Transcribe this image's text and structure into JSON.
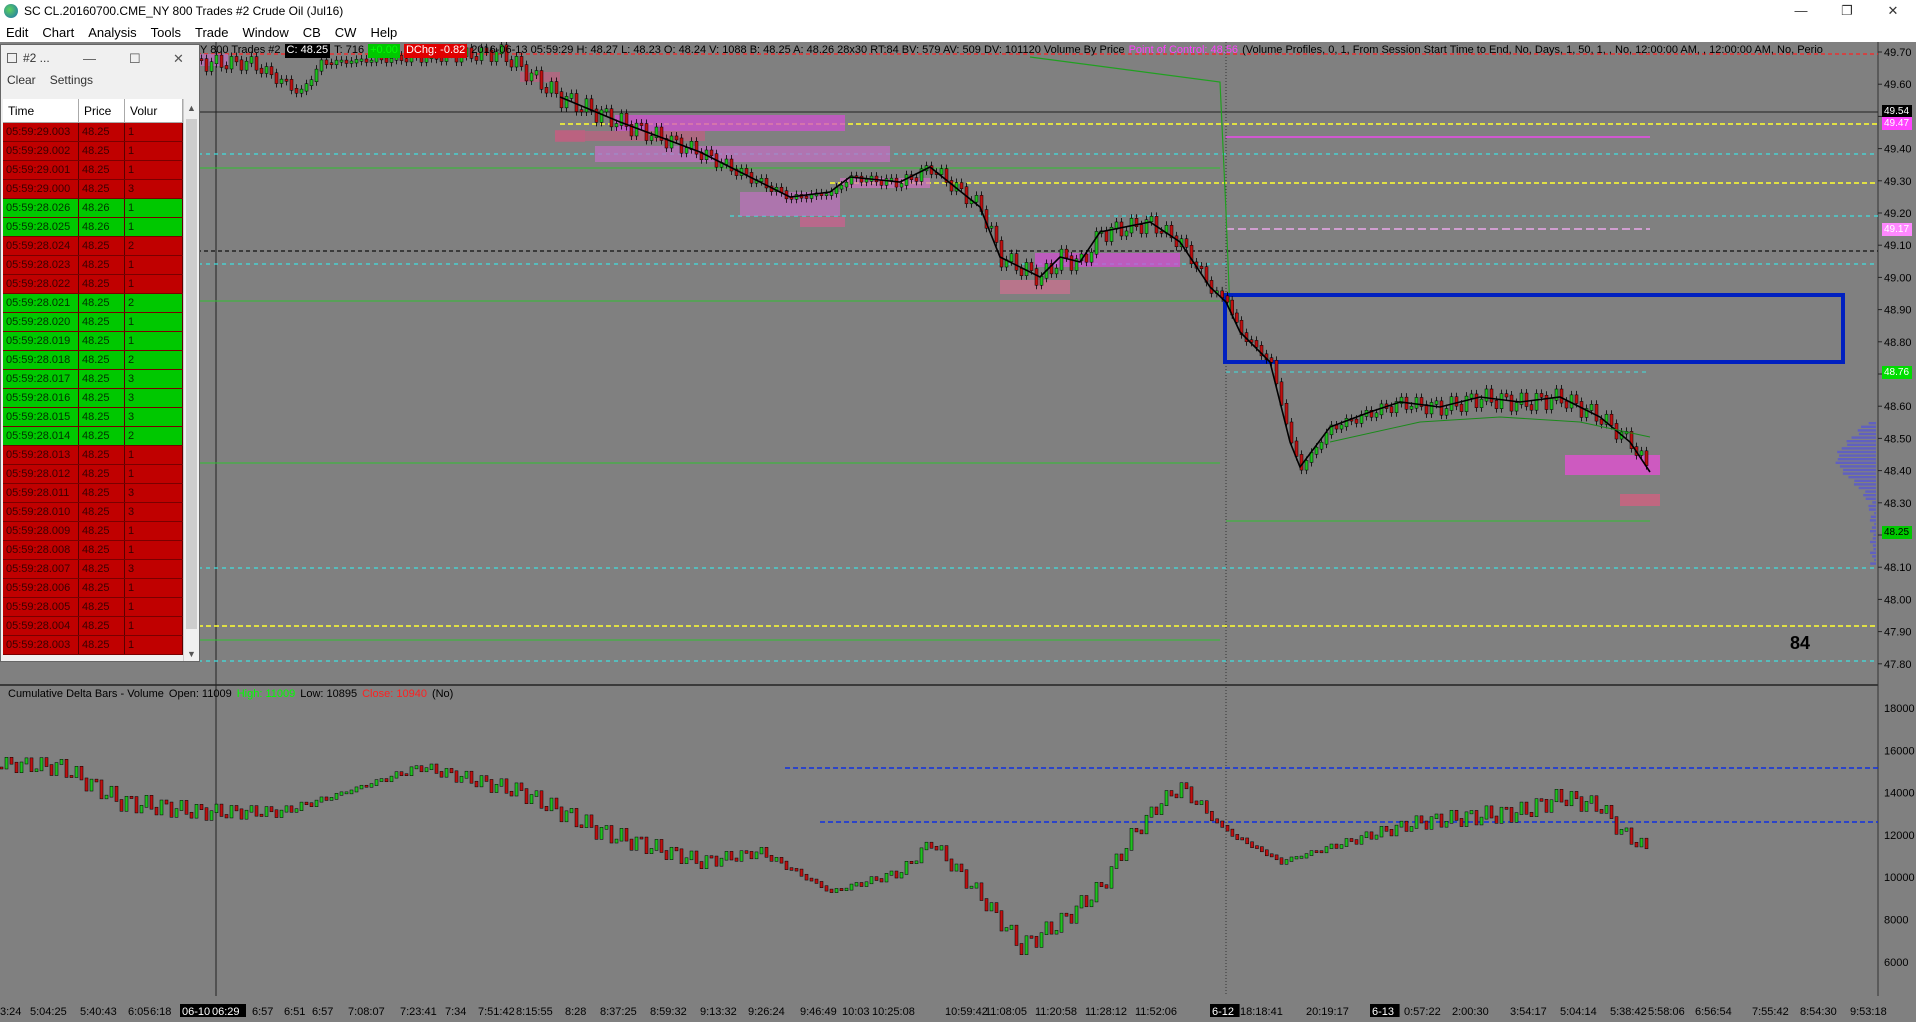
{
  "window": {
    "title": "SC CL.20160700.CME_NY  800 Trades  #2  Crude Oil (Jul16)",
    "buttons": [
      "—",
      "❐",
      "✕"
    ]
  },
  "menu": [
    "Edit",
    "Chart",
    "Analysis",
    "Tools",
    "Trade",
    "Window",
    "CB",
    "CW",
    "Help"
  ],
  "header": {
    "prefix": "Y  800 Trades  #2",
    "close_badge": "C: 48.25",
    "trades": "T: 716",
    "green_badge": "+0.00",
    "dchg_badge": "DChg: -0.82",
    "bar_info": "2016-06-13 05:59:29  H: 48.27  L: 48.23  O: 48.24  V: 1088  B: 48.25  A: 48.26  28x30  RT:84  BV: 579  AV: 509  DV: 101120  Volume By Price",
    "poc_text": "Point of Control: 48.56",
    "study_text": "(Volume Profiles, 0, 1, From Session Start Time to End, No, Days, 1, 50, 1, , No, 12:00:00 AM, , 12:00:00 AM, No, Perio"
  },
  "lower_header": {
    "name": "Cumulative Delta Bars - Volume",
    "open": "Open: 11009",
    "high": "High: 11009",
    "low": "Low: 10895",
    "close": "Close: 10940",
    "flag": "(No)"
  },
  "counter": "84",
  "price_axis": [
    "49.70",
    "49.60",
    "49.50",
    "49.40",
    "49.30",
    "49.20",
    "49.10",
    "49.00",
    "48.90",
    "48.80",
    "48.70",
    "48.60",
    "48.50",
    "48.40",
    "48.30",
    "48.20",
    "48.10",
    "48.00",
    "47.90",
    "47.80"
  ],
  "price_tags": [
    {
      "label": "49.54",
      "bg": "#000000",
      "fg": "#ffffff"
    },
    {
      "label": "49.47",
      "bg": "#ff44ff",
      "fg": "#ffffff"
    },
    {
      "label": "49.17",
      "bg": "#ff88ff",
      "fg": "#ffffff"
    },
    {
      "label": "48.76",
      "bg": "#00dd00",
      "fg": "#ffffff"
    },
    {
      "label": "48.25",
      "bg": "#00c800",
      "fg": "#000000"
    }
  ],
  "delta_axis": [
    "18000",
    "16000",
    "14000",
    "12000",
    "10000",
    "8000",
    "6000"
  ],
  "time_axis": [
    "3:24",
    "5:04:25",
    "5:40:43",
    "6:05",
    "6:18",
    "06-10",
    "06:29",
    "6:57",
    "6:51",
    "6:57",
    "7:08:07",
    "7:23:41",
    "7:34",
    "7:51:42",
    "8:15:55",
    "8:28",
    "8:37:25",
    "8:59:32",
    "9:13:32",
    "9:26:24",
    "9:46:49",
    "10:03",
    "10:25:08",
    "10:59:42",
    "11:08:05",
    "11:20:58",
    "11:28:12",
    "11:52:06",
    "6-12",
    "18:18:41",
    "20:19:17",
    "6-13",
    "0:57:22",
    "2:00:30",
    "3:54:17",
    "5:04:14",
    "5:38:42",
    "5:58:06",
    "6:56:54",
    "7:55:42",
    "8:54:30",
    "9:53:18"
  ],
  "tas": {
    "title": "#2 ...",
    "toolbar": [
      "Clear",
      "Settings"
    ],
    "columns": [
      "Time",
      "Price",
      "Volur"
    ],
    "rows": [
      {
        "time": "05:59:29.003",
        "price": "48.25",
        "vol": "1",
        "side": "sell"
      },
      {
        "time": "05:59:29.002",
        "price": "48.25",
        "vol": "1",
        "side": "sell"
      },
      {
        "time": "05:59:29.001",
        "price": "48.25",
        "vol": "1",
        "side": "sell"
      },
      {
        "time": "05:59:29.000",
        "price": "48.25",
        "vol": "3",
        "side": "sell"
      },
      {
        "time": "05:59:28.026",
        "price": "48.26",
        "vol": "1",
        "side": "buy"
      },
      {
        "time": "05:59:28.025",
        "price": "48.26",
        "vol": "1",
        "side": "buy"
      },
      {
        "time": "05:59:28.024",
        "price": "48.25",
        "vol": "2",
        "side": "sell"
      },
      {
        "time": "05:59:28.023",
        "price": "48.25",
        "vol": "1",
        "side": "sell"
      },
      {
        "time": "05:59:28.022",
        "price": "48.25",
        "vol": "1",
        "side": "sell"
      },
      {
        "time": "05:59:28.021",
        "price": "48.25",
        "vol": "2",
        "side": "buy"
      },
      {
        "time": "05:59:28.020",
        "price": "48.25",
        "vol": "1",
        "side": "buy"
      },
      {
        "time": "05:59:28.019",
        "price": "48.25",
        "vol": "1",
        "side": "buy"
      },
      {
        "time": "05:59:28.018",
        "price": "48.25",
        "vol": "2",
        "side": "buy"
      },
      {
        "time": "05:59:28.017",
        "price": "48.25",
        "vol": "3",
        "side": "buy"
      },
      {
        "time": "05:59:28.016",
        "price": "48.25",
        "vol": "3",
        "side": "buy"
      },
      {
        "time": "05:59:28.015",
        "price": "48.25",
        "vol": "3",
        "side": "buy"
      },
      {
        "time": "05:59:28.014",
        "price": "48.25",
        "vol": "2",
        "side": "buy"
      },
      {
        "time": "05:59:28.013",
        "price": "48.25",
        "vol": "1",
        "side": "sell"
      },
      {
        "time": "05:59:28.012",
        "price": "48.25",
        "vol": "1",
        "side": "sell"
      },
      {
        "time": "05:59:28.011",
        "price": "48.25",
        "vol": "3",
        "side": "sell"
      },
      {
        "time": "05:59:28.010",
        "price": "48.25",
        "vol": "3",
        "side": "sell"
      },
      {
        "time": "05:59:28.009",
        "price": "48.25",
        "vol": "1",
        "side": "sell"
      },
      {
        "time": "05:59:28.008",
        "price": "48.25",
        "vol": "1",
        "side": "sell"
      },
      {
        "time": "05:59:28.007",
        "price": "48.25",
        "vol": "3",
        "side": "sell"
      },
      {
        "time": "05:59:28.006",
        "price": "48.25",
        "vol": "1",
        "side": "sell"
      },
      {
        "time": "05:59:28.005",
        "price": "48.25",
        "vol": "1",
        "side": "sell"
      },
      {
        "time": "05:59:28.004",
        "price": "48.25",
        "vol": "1",
        "side": "sell"
      },
      {
        "time": "05:59:28.003",
        "price": "48.25",
        "vol": "1",
        "side": "sell"
      }
    ]
  }
}
